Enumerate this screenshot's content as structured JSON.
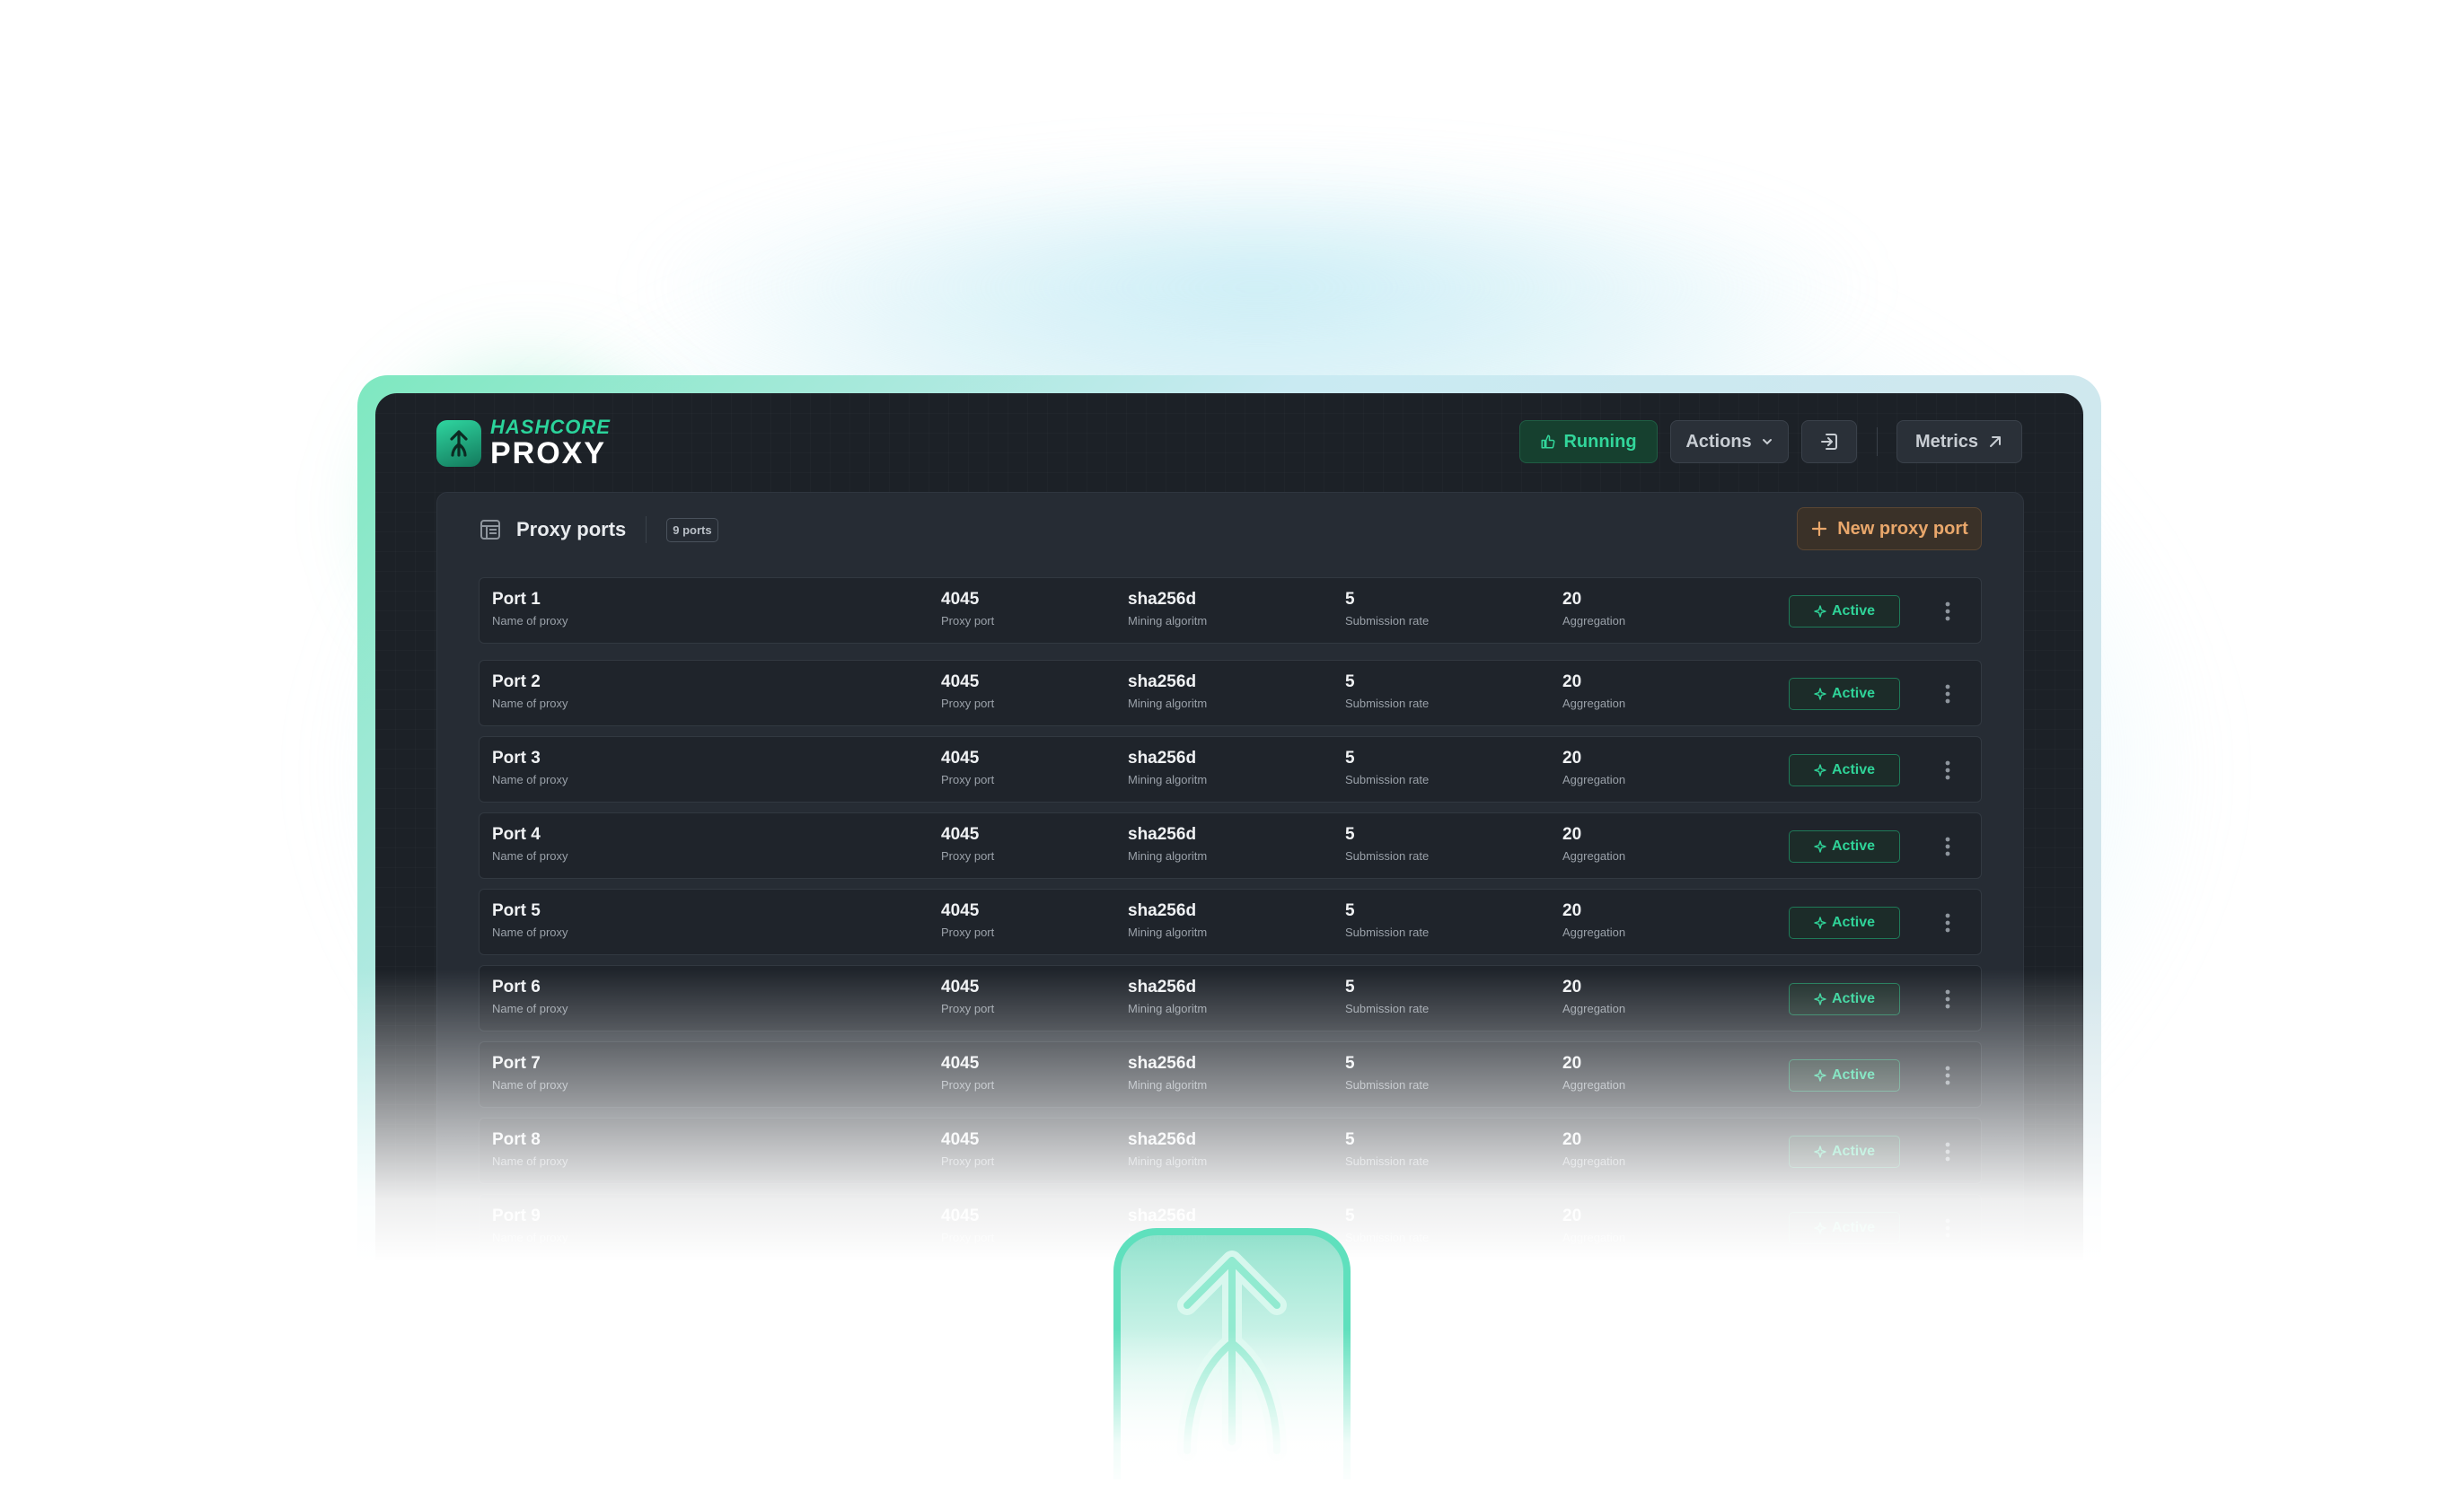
{
  "brand": {
    "line1": "HASHCORE",
    "line2": "PROXY"
  },
  "header": {
    "running_label": "Running",
    "actions_label": "Actions",
    "metrics_label": "Metrics"
  },
  "panel": {
    "title": "Proxy ports",
    "count_badge": "9 ports",
    "new_button_label": "New proxy port"
  },
  "columns": {
    "name": "Name of proxy",
    "port": "Proxy port",
    "algo": "Mining algoritm",
    "rate": "Submission rate",
    "agg": "Aggregation"
  },
  "rows": [
    {
      "name": "Port 1",
      "port": "4045",
      "algo": "sha256d",
      "rate": "5",
      "agg": "20",
      "status": "Active"
    },
    {
      "name": "Port 2",
      "port": "4045",
      "algo": "sha256d",
      "rate": "5",
      "agg": "20",
      "status": "Active"
    },
    {
      "name": "Port 3",
      "port": "4045",
      "algo": "sha256d",
      "rate": "5",
      "agg": "20",
      "status": "Active"
    },
    {
      "name": "Port 4",
      "port": "4045",
      "algo": "sha256d",
      "rate": "5",
      "agg": "20",
      "status": "Active"
    },
    {
      "name": "Port 5",
      "port": "4045",
      "algo": "sha256d",
      "rate": "5",
      "agg": "20",
      "status": "Active"
    },
    {
      "name": "Port 6",
      "port": "4045",
      "algo": "sha256d",
      "rate": "5",
      "agg": "20",
      "status": "Active"
    },
    {
      "name": "Port 7",
      "port": "4045",
      "algo": "sha256d",
      "rate": "5",
      "agg": "20",
      "status": "Active"
    },
    {
      "name": "Port 8",
      "port": "4045",
      "algo": "sha256d",
      "rate": "5",
      "agg": "20",
      "status": "Active"
    },
    {
      "name": "Port 9",
      "port": "4045",
      "algo": "sha256d",
      "rate": "5",
      "agg": "20",
      "status": "Active"
    }
  ],
  "colors": {
    "accent": "#2fd398",
    "background": "#1c2127",
    "orange": "#e9a76b"
  },
  "icons": [
    "logo-icon",
    "thumbs-up-icon",
    "chevron-down-icon",
    "exit-icon",
    "arrow-up-right-icon",
    "table-icon",
    "plus-icon",
    "sparkle-icon",
    "kebab-icon",
    "app-arrow-icon"
  ]
}
